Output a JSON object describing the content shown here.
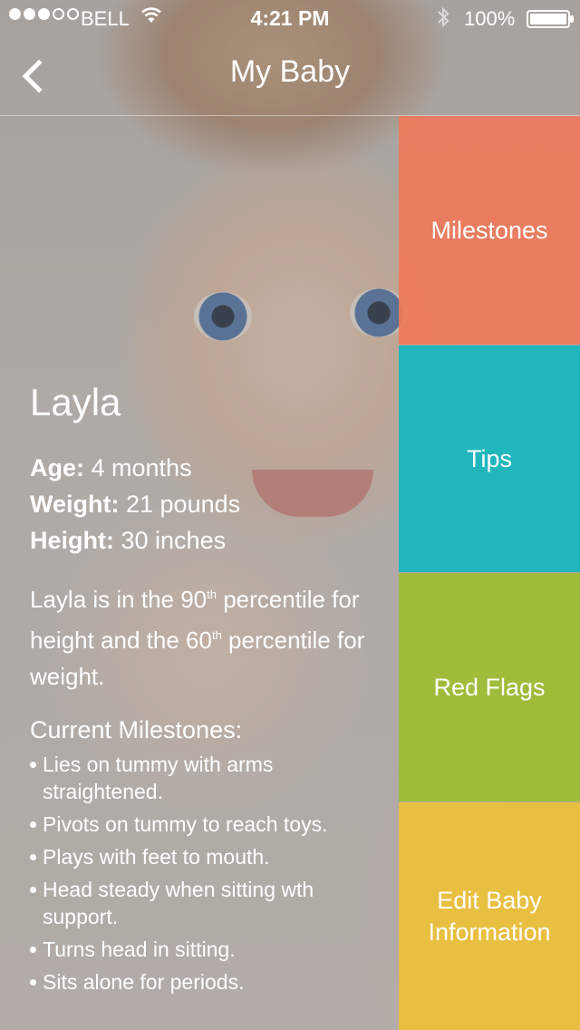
{
  "status_bar": {
    "carrier": "BELL",
    "time": "4:21 PM",
    "battery_percent": "100%",
    "signal_bars": 3,
    "signal_total": 5,
    "icons": [
      "wifi-icon",
      "bluetooth-icon",
      "battery-icon"
    ]
  },
  "nav": {
    "title": "My Baby",
    "back_icon": "chevron-left-icon"
  },
  "profile": {
    "name": "Layla",
    "stats": [
      {
        "label": "Age:",
        "value": "4 months"
      },
      {
        "label": "Weight:",
        "value": "21 pounds"
      },
      {
        "label": "Height:",
        "value": "30 inches"
      }
    ],
    "percentile": {
      "part1": "Layla is in the 90",
      "sup1": "th",
      "part2": " percentile for height and the 60",
      "sup2": "th",
      "part3": " percentile for weight."
    },
    "milestones_heading": "Current Milestones:",
    "milestones": [
      "Lies on tummy with arms straightened.",
      "Pivots on tummy to reach toys.",
      "Plays with feet to mouth.",
      "Head steady when sitting wth support.",
      "Turns head in sitting.",
      "Sits alone for periods."
    ]
  },
  "tiles": [
    {
      "label": "Milestones",
      "color": "#EF785A"
    },
    {
      "label": "Tips",
      "color": "#14B7BE"
    },
    {
      "label": "Red Flags",
      "color": "#9DBE32"
    },
    {
      "label": "Edit Baby Information",
      "color": "#ECC03C"
    }
  ]
}
